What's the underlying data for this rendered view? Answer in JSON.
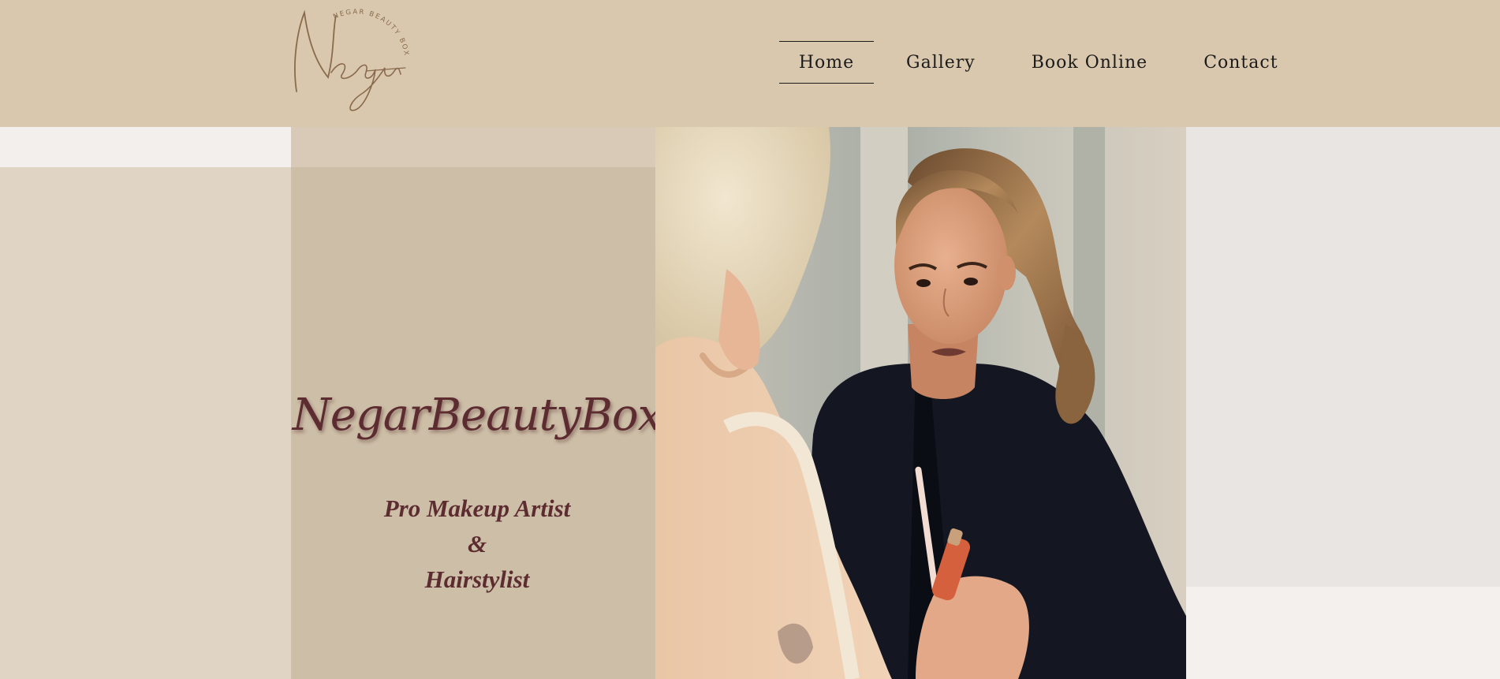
{
  "logo": {
    "script_text": "Negar",
    "arc_text": "NEGAR BEAUTY BOX"
  },
  "nav": {
    "items": [
      {
        "label": "Home",
        "active": true
      },
      {
        "label": "Gallery",
        "active": false
      },
      {
        "label": "Book Online",
        "active": false
      },
      {
        "label": "Contact",
        "active": false
      }
    ]
  },
  "hero": {
    "brand": "NegarBeautyBox",
    "tagline_line1": "Pro Makeup Artist",
    "tagline_line2": "&",
    "tagline_line3": "Hairstylist",
    "photo_alt": "makeup artist applying lip gloss"
  },
  "colors": {
    "header_bg": "#d9c8ae",
    "accent_text": "#5c2c31",
    "logo": "#8a6a4c"
  }
}
